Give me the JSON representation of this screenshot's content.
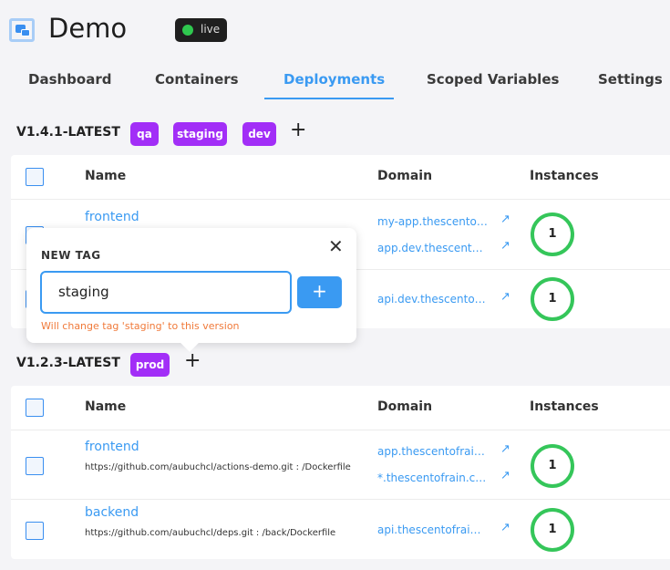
{
  "app": {
    "title": "Demo",
    "status": "live",
    "status_color": "#2fc84f"
  },
  "tabs": [
    {
      "label": "Dashboard"
    },
    {
      "label": "Containers"
    },
    {
      "label": "Deployments",
      "active": true
    },
    {
      "label": "Scoped Variables"
    },
    {
      "label": "Settings"
    }
  ],
  "columns": {
    "name": "Name",
    "domain": "Domain",
    "instances": "Instances"
  },
  "versions": [
    {
      "label": "V1.4.1-LATEST",
      "tags": [
        "qa",
        "staging",
        "dev"
      ],
      "rows": [
        {
          "name": "frontend",
          "source": "",
          "domains": [
            "my-app.thescento…",
            "app.dev.thescent…"
          ],
          "instances": "1"
        },
        {
          "name": "",
          "source": "",
          "domains": [
            "api.dev.thescento…"
          ],
          "instances": "1"
        }
      ]
    },
    {
      "label": "V1.2.3-LATEST",
      "tags": [
        "prod"
      ],
      "rows": [
        {
          "name": "frontend",
          "source": "https://github.com/aubuchcl/actions-demo.git : /Dockerfile",
          "domains": [
            "app.thescentofrai…",
            "*.thescentofrain.c…"
          ],
          "instances": "1"
        },
        {
          "name": "backend",
          "source": "https://github.com/aubuchcl/deps.git : /back/Dockerfile",
          "domains": [
            "api.thescentofrai…"
          ],
          "instances": "1"
        }
      ]
    }
  ],
  "popover": {
    "label": "NEW TAG",
    "value": "staging",
    "hint": "Will change tag 'staging' to this version",
    "add_label": "+",
    "close_label": "✕"
  },
  "colors": {
    "accent": "#3a9af2",
    "tag": "#a22ef7",
    "hint": "#f07a3a"
  }
}
